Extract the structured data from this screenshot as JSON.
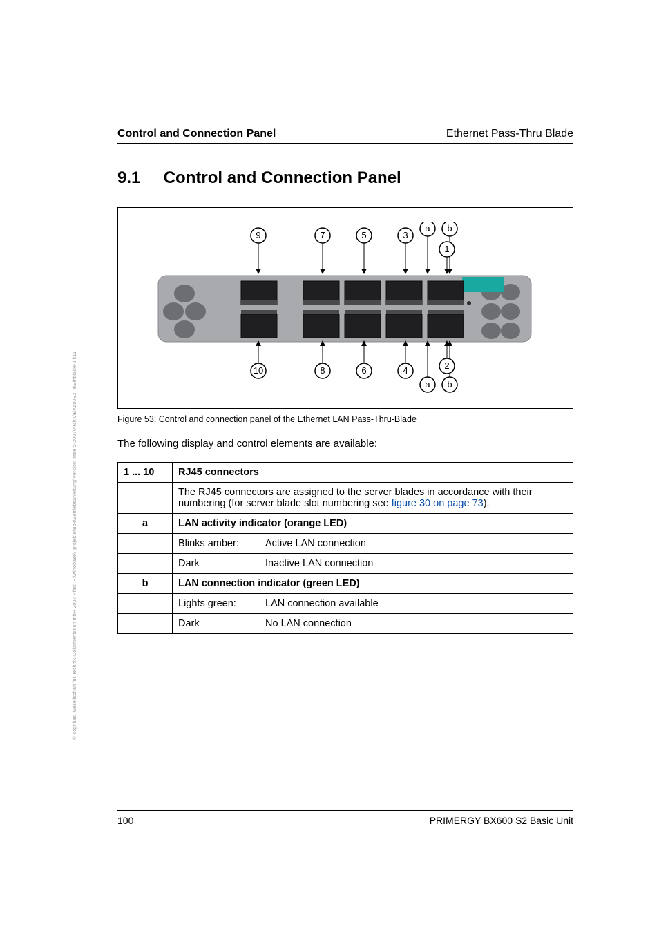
{
  "side_note": "© cognitas. Gesellschaft für Technik-Dokumentation mbH 2007     Pfad: H:\\winobase\\_projekte\\Box\\Betriebsanleitung\\Version_Maerz-2007\\Archiv\\BX600S2_e\\Ethblade-u.k11",
  "header": {
    "left": "Control and Connection Panel",
    "right": "Ethernet Pass-Thru Blade"
  },
  "section": {
    "number": "9.1",
    "title": "Control and Connection Panel"
  },
  "figure": {
    "caption": "Figure 53: Control and connection panel of the Ethernet LAN Pass-Thru-Blade",
    "labels_top": [
      "9",
      "7",
      "5",
      "3",
      "a",
      "b",
      "1"
    ],
    "labels_bottom": [
      "10",
      "8",
      "6",
      "4",
      "a",
      "b",
      "2"
    ]
  },
  "intro": "The following display and control elements are available:",
  "table": {
    "r1_key": "1 ... 10",
    "r1_head": "RJ45 connectors",
    "r1_body_pre": "The RJ45 connectors are assigned to the server blades in accordance with their numbering (for server blade slot numbering see ",
    "r1_body_link": "figure 30 on page 73",
    "r1_body_post": ").",
    "r2_key": "a",
    "r2_head": "LAN activity indicator (orange LED)",
    "r2_s1_l": "Blinks amber:",
    "r2_s1_r": "Active LAN connection",
    "r2_s2_l": "Dark",
    "r2_s2_r": "Inactive LAN connection",
    "r3_key": "b",
    "r3_head": "LAN connection indicator (green LED)",
    "r3_s1_l": "Lights green:",
    "r3_s1_r": "LAN connection available",
    "r3_s2_l": "Dark",
    "r3_s2_r": "No LAN connection"
  },
  "footer": {
    "page": "100",
    "doc": "PRIMERGY BX600 S2 Basic Unit"
  }
}
